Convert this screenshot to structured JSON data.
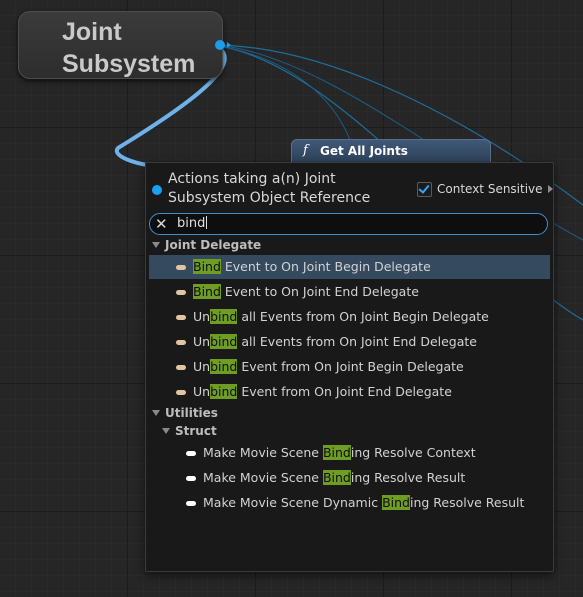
{
  "graph": {
    "joint_subsystem_node": {
      "title_line1": "Joint",
      "title_line2": "Subsystem",
      "pin_color": "#1e9bea"
    },
    "get_all_joints_node": {
      "function_glyph": "f",
      "title": "Get All Joints",
      "header_color": "#3f5977"
    }
  },
  "action_menu": {
    "header_line1": "Actions taking a(n) Joint",
    "header_line2": "Subsystem Object Reference",
    "context_sensitive_label": "Context Sensitive",
    "context_sensitive_checked": true,
    "search": {
      "clear_icon": "close-icon",
      "value": "bind"
    },
    "highlight_color": "#6f9c23",
    "categories": [
      {
        "label": "Joint Delegate",
        "icon": "delegate-pin-icon",
        "icon_color": "#e2c4a0",
        "items": [
          {
            "pre": "",
            "match": "Bind",
            "post": " Event to On Joint Begin Delegate",
            "selected": true
          },
          {
            "pre": "",
            "match": "Bind",
            "post": " Event to On Joint End Delegate"
          },
          {
            "pre": "Un",
            "match": "bind",
            "post": " all Events from On Joint Begin Delegate"
          },
          {
            "pre": "Un",
            "match": "bind",
            "post": " all Events from On Joint End Delegate"
          },
          {
            "pre": "Un",
            "match": "bind",
            "post": " Event from On Joint Begin Delegate"
          },
          {
            "pre": "Un",
            "match": "bind",
            "post": " Event from On Joint End Delegate"
          }
        ]
      },
      {
        "label": "Utilities",
        "subcategory": "Struct",
        "icon": "function-pin-icon",
        "icon_color": "#ffffff",
        "items": [
          {
            "pre": "Make Movie Scene ",
            "match": "Bind",
            "post": "ing Resolve Context"
          },
          {
            "pre": "Make Movie Scene ",
            "match": "Bind",
            "post": "ing Resolve Result"
          },
          {
            "pre": "Make Movie Scene Dynamic ",
            "match": "Bind",
            "post": "ing Resolve Result"
          }
        ]
      }
    ]
  }
}
